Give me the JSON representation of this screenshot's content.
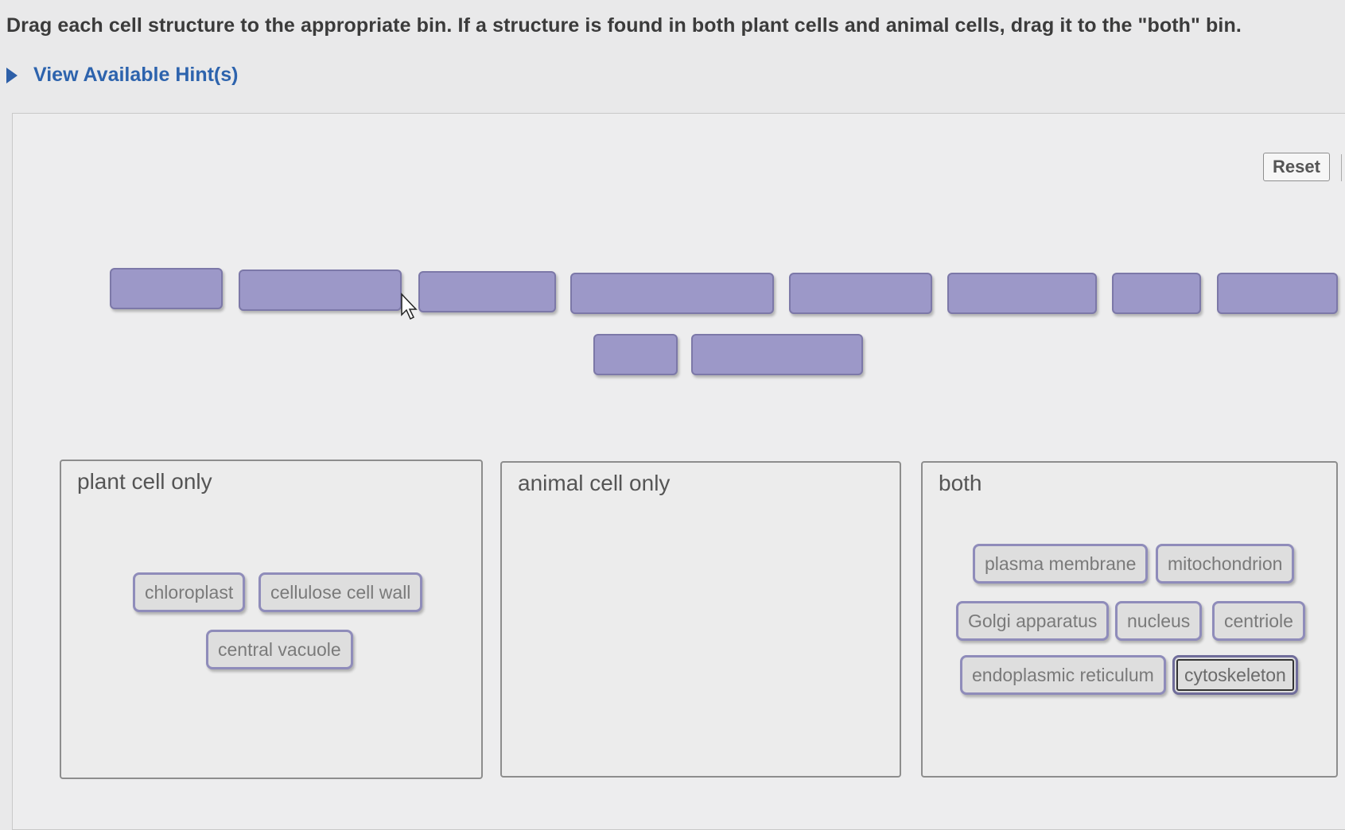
{
  "instructions": "Drag each cell structure to the appropriate bin. If a structure is found in both plant cells and animal cells, drag it to the \"both\" bin.",
  "hint_link": "View Available Hint(s)",
  "reset_label": "Reset",
  "empty_slot_count": 10,
  "bins": {
    "plant": {
      "title": "plant cell only",
      "items": [
        "chloroplast",
        "cellulose cell wall",
        "central vacuole"
      ]
    },
    "animal": {
      "title": "animal cell only",
      "items": []
    },
    "both": {
      "title": "both",
      "items": [
        "plasma membrane",
        "mitochondrion",
        "Golgi apparatus",
        "nucleus",
        "centriole",
        "endoplasmic reticulum",
        "cytoskeleton"
      ]
    }
  },
  "colors": {
    "slot_fill": "#9c98c8",
    "chip_border": "#8f8cba",
    "hint_link": "#2d63ad"
  }
}
